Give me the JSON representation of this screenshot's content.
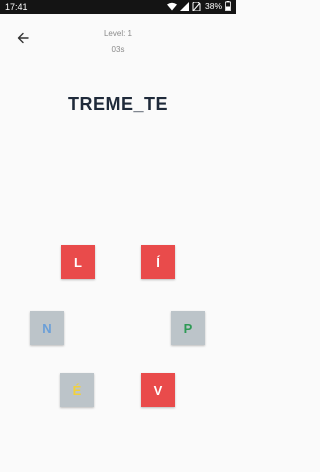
{
  "status_bar": {
    "time": "17:41",
    "battery": "38%"
  },
  "header": {
    "level": "Level: 1",
    "timer": "03s"
  },
  "puzzle": {
    "word": "TREME_TE"
  },
  "tiles": [
    {
      "letter": "L",
      "style": "red"
    },
    {
      "letter": "Í",
      "style": "red"
    },
    {
      "letter": "N",
      "style": "gray",
      "color": "#6a9fd8"
    },
    {
      "letter": "P",
      "style": "gray",
      "color": "#2e9a55"
    },
    {
      "letter": "É",
      "style": "gray",
      "color": "#f2d13b"
    },
    {
      "letter": "V",
      "style": "red"
    }
  ],
  "colors": {
    "accent_red": "#e94b4b",
    "tile_gray": "#bcc4c9",
    "word_text": "#1f2a3a"
  }
}
